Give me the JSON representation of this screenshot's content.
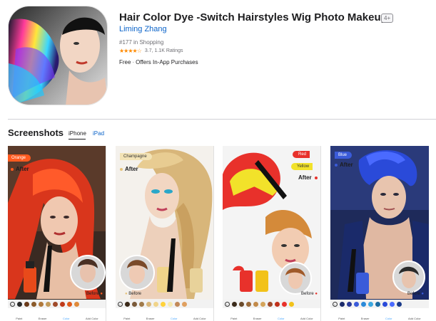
{
  "app": {
    "title": "Hair Color Dye -Switch Hairstyles Wig Photo Makeup",
    "age_rating": "4+",
    "developer": "Liming Zhang",
    "rank": "#177 in Shopping",
    "rating_value": "3.7",
    "ratings_count": "1.1K Ratings",
    "rating_text": "3.7, 1.1K Ratings",
    "stars_visual": "★★★★☆",
    "price": "Free",
    "iap": "Offers In-App Purchases"
  },
  "screenshots": {
    "title": "Screenshots",
    "tabs": [
      {
        "label": "iPhone",
        "selected": true
      },
      {
        "label": "iPad",
        "selected": false
      }
    ],
    "items": [
      {
        "tags": [
          {
            "label": "Orange",
            "color": "#ff5a1f"
          }
        ],
        "after_label": "After",
        "before_label": "Before",
        "dot_color": "#ff5a1f"
      },
      {
        "tags": [
          {
            "label": "Champagne",
            "color": "#f3e3b5"
          }
        ],
        "after_label": "After",
        "before_label": "Before",
        "dot_color": "#e5c27a"
      },
      {
        "tags": [
          {
            "label": "Red",
            "color": "#e8312b"
          },
          {
            "label": "Yellow",
            "color": "#f2e22a"
          }
        ],
        "after_label": "After",
        "before_label": "Before",
        "dot_color": "#e8312b"
      },
      {
        "tags": [
          {
            "label": "Blue",
            "color": "#3a5bd9"
          }
        ],
        "after_label": "After",
        "before_label": "Before",
        "dot_color": "#3a5bd9"
      }
    ]
  },
  "colors": {
    "link_blue": "#0a63c9",
    "star_orange": "#ff8a00",
    "divider": "#d2d2d7"
  }
}
